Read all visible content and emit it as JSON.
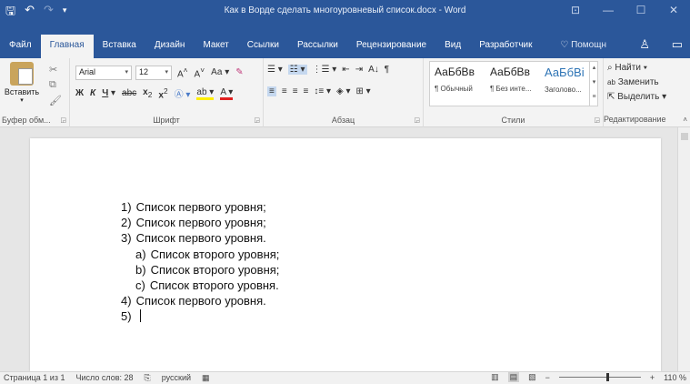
{
  "window": {
    "title": "Как в Ворде сделать многоуровневый список.docx - Word",
    "quick_access": [
      "save-icon",
      "undo-icon",
      "redo-icon",
      "customize-icon"
    ],
    "controls": [
      "ribbon-display-icon",
      "minimize-icon",
      "maximize-icon",
      "close-icon"
    ]
  },
  "tabs": [
    {
      "label": "Файл"
    },
    {
      "label": "Главная"
    },
    {
      "label": "Вставка"
    },
    {
      "label": "Дизайн"
    },
    {
      "label": "Макет"
    },
    {
      "label": "Ссылки"
    },
    {
      "label": "Рассылки"
    },
    {
      "label": "Рецензирование"
    },
    {
      "label": "Вид"
    },
    {
      "label": "Разработчик"
    }
  ],
  "active_tab": "Главная",
  "help": {
    "label": "Помощн"
  },
  "ribbon": {
    "clipboard": {
      "paste_label": "Вставить",
      "group_label": "Буфер обм..."
    },
    "font": {
      "family": "Arial",
      "size": "12",
      "group_label": "Шрифт",
      "case_label": "Аа"
    },
    "paragraph": {
      "group_label": "Абзац"
    },
    "styles": {
      "group_label": "Стили",
      "items": [
        {
          "preview": "АаБбВв",
          "name": "¶ Обычный"
        },
        {
          "preview": "АаБбВв",
          "name": "¶ Без инте..."
        },
        {
          "preview": "АаБбВі",
          "name": "Заголово..."
        }
      ]
    },
    "editing": {
      "group_label": "Редактирование",
      "find_label": "Найти",
      "replace_label": "Заменить",
      "select_label": "Выделить"
    }
  },
  "document": {
    "list": [
      {
        "marker": "1)",
        "text": "Список первого уровня;",
        "level": 1
      },
      {
        "marker": "2)",
        "text": "Список первого уровня;",
        "level": 1
      },
      {
        "marker": "3)",
        "text": "Список первого уровня.",
        "level": 1
      },
      {
        "marker": "a)",
        "text": "Список второго уровня;",
        "level": 2
      },
      {
        "marker": "b)",
        "text": "Список второго уровня;",
        "level": 2
      },
      {
        "marker": "c)",
        "text": "Список второго уровня.",
        "level": 2
      },
      {
        "marker": "4)",
        "text": "Список первого уровня.",
        "level": 1
      },
      {
        "marker": "5)",
        "text": "",
        "level": 1
      }
    ]
  },
  "status": {
    "page": "Страница 1 из 1",
    "words": "Число слов: 28",
    "language": "русский",
    "zoom": "110 %",
    "zoom_minus": "−",
    "zoom_plus": "+"
  }
}
